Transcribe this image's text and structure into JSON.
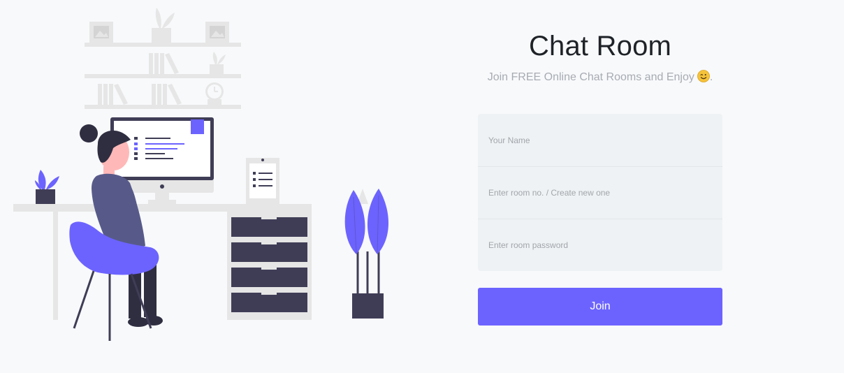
{
  "header": {
    "title": "Chat Room",
    "subtitle": "Join FREE Online Chat Rooms and Enjoy",
    "subtitle_suffix": ".",
    "emoji_icon": "winking-face-emoji"
  },
  "form": {
    "name_placeholder": "Your Name",
    "room_placeholder": "Enter room no. / Create new one",
    "password_placeholder": "Enter room password",
    "join_label": "Join"
  },
  "colors": {
    "accent": "#6c63ff",
    "dark": "#3f3d56",
    "light_gray": "#e6e6e6",
    "background": "#f8f9fb",
    "skin": "#ffb8b8"
  }
}
